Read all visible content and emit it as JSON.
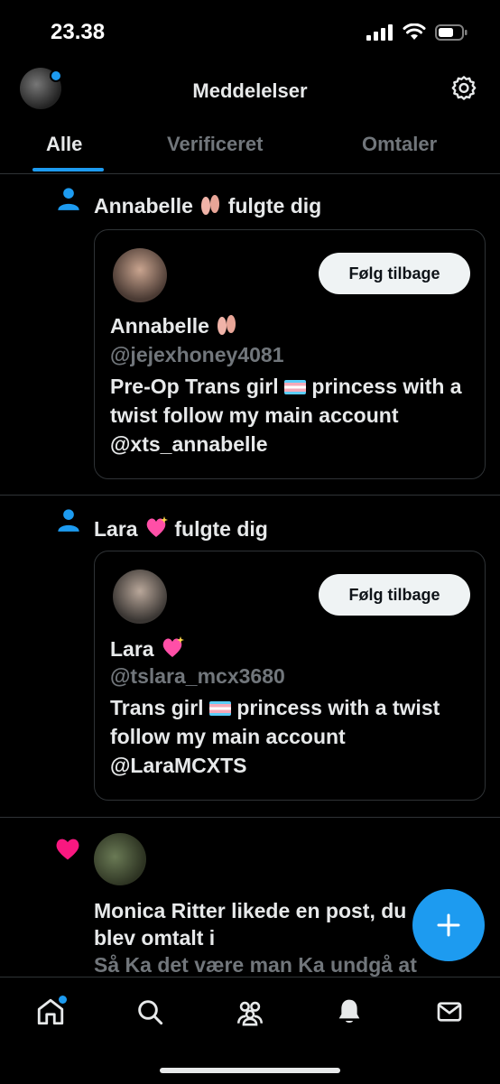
{
  "status_bar": {
    "time": "23.38"
  },
  "header": {
    "title": "Meddelelser"
  },
  "tabs": [
    {
      "label": "Alle"
    },
    {
      "label": "Verificeret"
    },
    {
      "label": "Omtaler"
    }
  ],
  "notifications": [
    {
      "name": "Annabelle",
      "action": "fulgte dig",
      "handle": "@jejexhoney4081",
      "bio_parts": [
        "Pre-Op Trans girl",
        "princess with a twist follow my main account @xts_annabelle"
      ],
      "follow_label": "Følg tilbage"
    },
    {
      "name": "Lara",
      "action": "fulgte dig",
      "handle": "@tslara_mcx3680",
      "bio_parts": [
        "Trans girl",
        "princess with a twist follow my main account @LaraMCXTS"
      ],
      "follow_label": "Følg tilbage"
    }
  ],
  "like": {
    "text": "Monica Ritter likede en post, du blev omtalt i",
    "snippet": "Så Ka det være man Ka undgå at"
  },
  "colors": {
    "accent": "#1d9bf0",
    "like": "#f91880",
    "background": "#000000"
  }
}
